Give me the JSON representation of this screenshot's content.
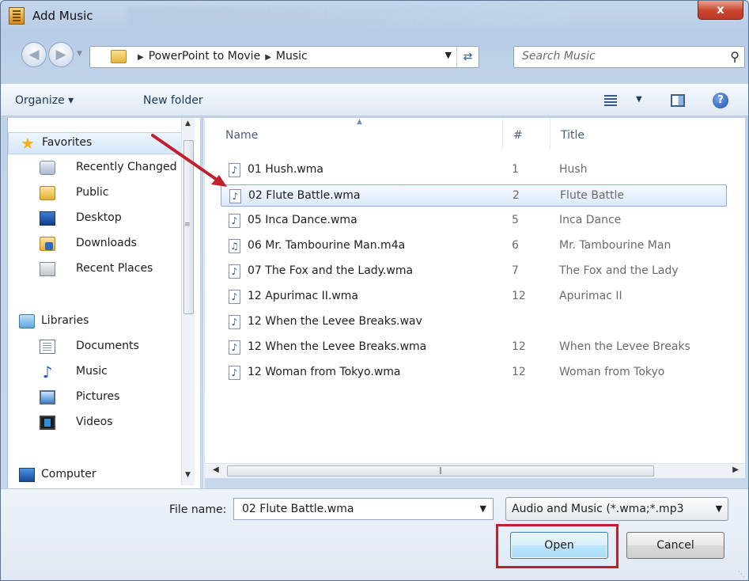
{
  "window": {
    "title": "Add Music",
    "close_label": "x"
  },
  "address": {
    "crumbs": [
      "PowerPoint to Movie",
      "Music"
    ],
    "search_placeholder": "Search Music"
  },
  "toolbar": {
    "organize_label": "Organize ▾",
    "new_folder_label": "New folder",
    "help_label": "?"
  },
  "nav": {
    "favorites_label": "Favorites",
    "favorites_items": [
      "Recently Changed",
      "Public",
      "Desktop",
      "Downloads",
      "Recent Places"
    ],
    "libraries_label": "Libraries",
    "libraries_items": [
      "Documents",
      "Music",
      "Pictures",
      "Videos"
    ],
    "computer_label": "Computer"
  },
  "files": {
    "columns": [
      "Name",
      "#",
      "Title"
    ],
    "rows": [
      {
        "name": "01 Hush.wma",
        "num": "1",
        "title": "Hush"
      },
      {
        "name": "02 Flute Battle.wma",
        "num": "2",
        "title": "Flute Battle"
      },
      {
        "name": "05 Inca Dance.wma",
        "num": "5",
        "title": "Inca Dance"
      },
      {
        "name": "06 Mr. Tambourine Man.m4a",
        "num": "6",
        "title": "Mr. Tambourine Man"
      },
      {
        "name": "07 The Fox and the Lady.wma",
        "num": "7",
        "title": "The Fox and the Lady"
      },
      {
        "name": "12 Apurimac II.wma",
        "num": "12",
        "title": "Apurimac II"
      },
      {
        "name": "12 When the Levee Breaks.wav",
        "num": "",
        "title": ""
      },
      {
        "name": "12 When the Levee Breaks.wma",
        "num": "12",
        "title": "When the Levee Breaks"
      },
      {
        "name": "12 Woman from Tokyo.wma",
        "num": "12",
        "title": "Woman from Tokyo"
      }
    ],
    "selected_index": 1
  },
  "bottom": {
    "file_name_label": "File name:",
    "file_name_value": "02 Flute Battle.wma",
    "filter_value": "Audio and Music (*.wma;*.mp3",
    "open_label": "Open",
    "cancel_label": "Cancel"
  },
  "colors": {
    "annotation_red": "#c0202c",
    "selection_blue": "#84acdd"
  }
}
